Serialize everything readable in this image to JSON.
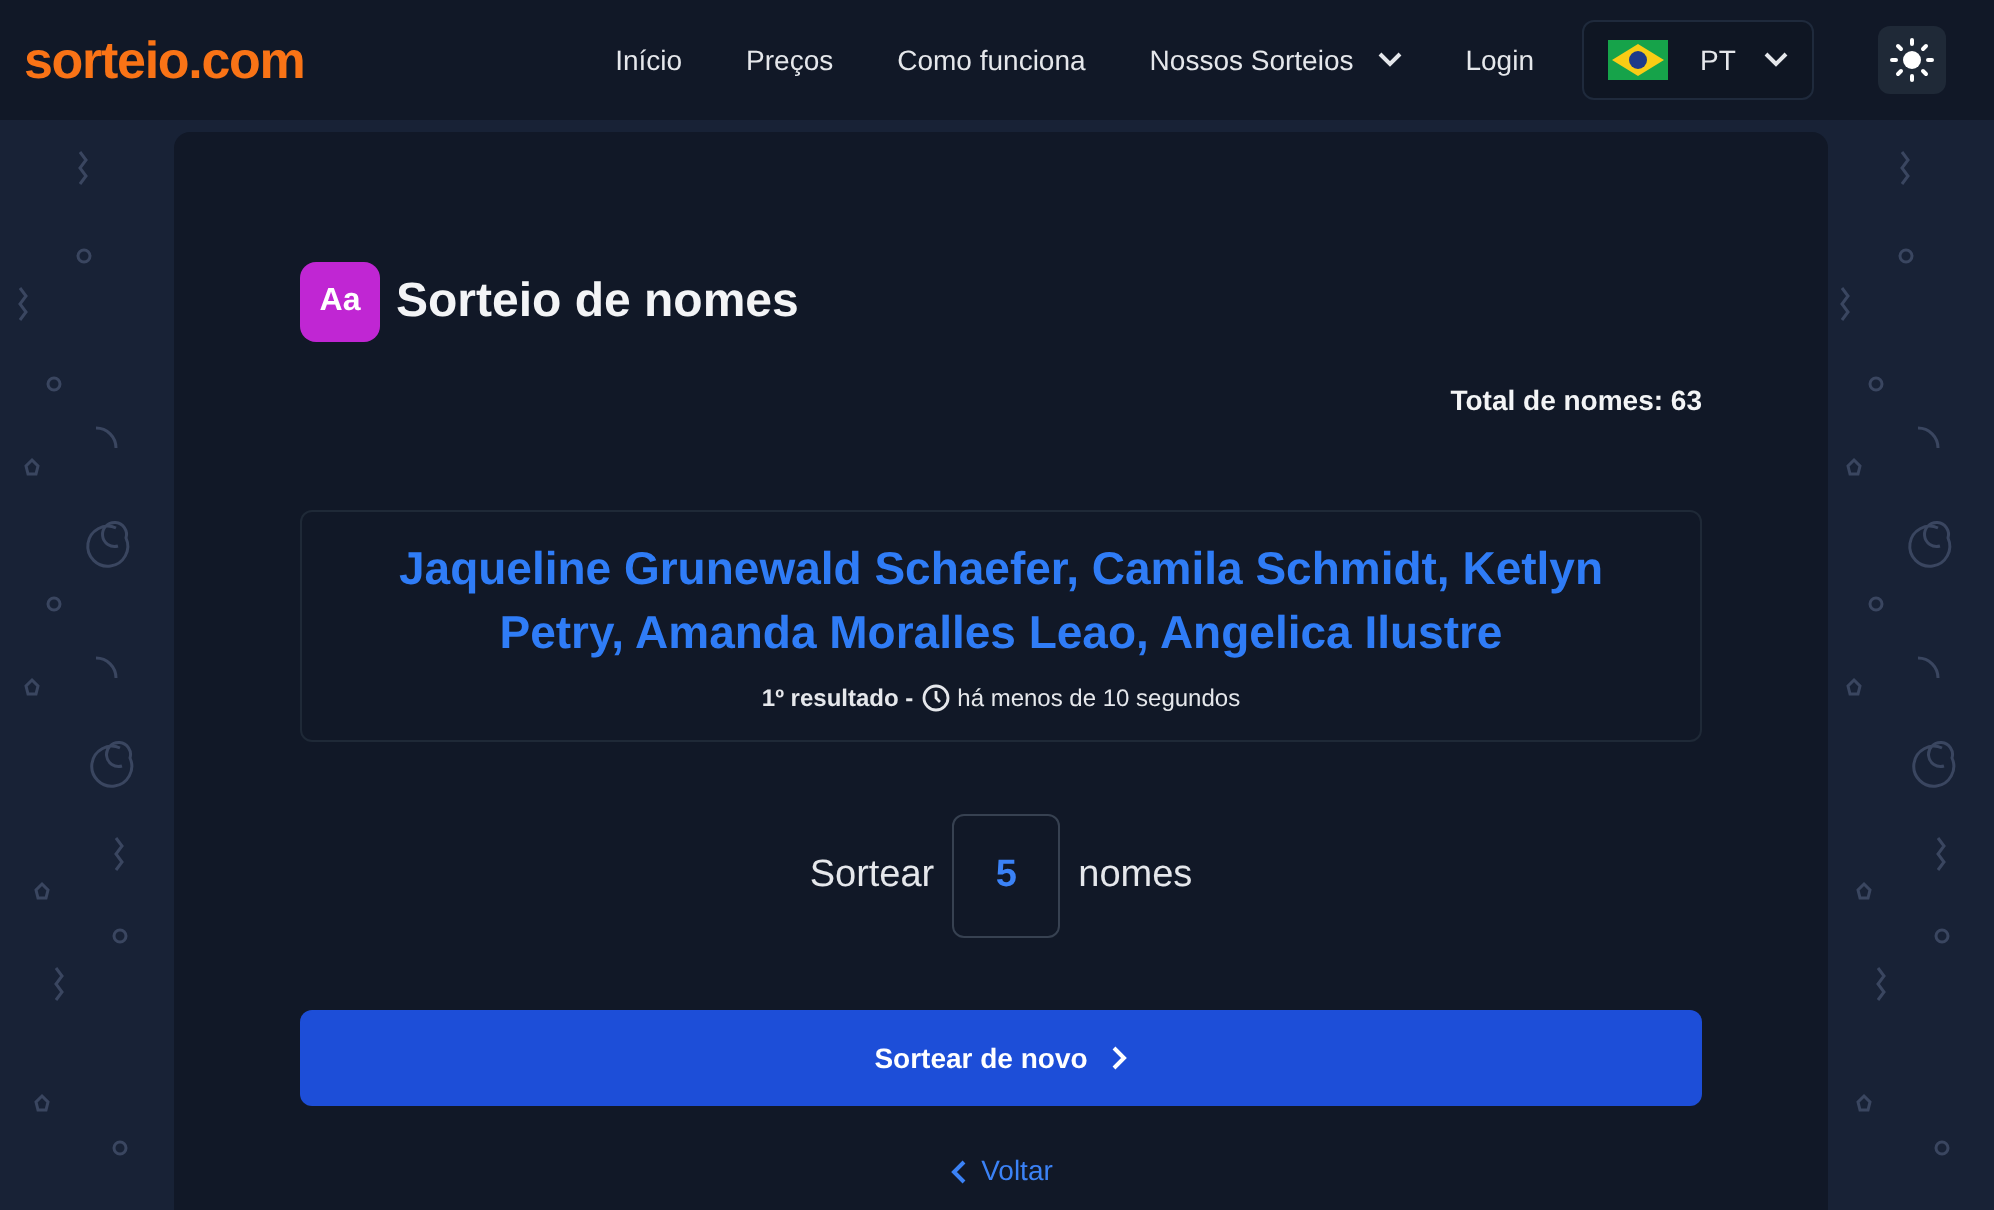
{
  "logo": "sorteio.com",
  "nav": [
    {
      "label": "Início",
      "dropdown": false
    },
    {
      "label": "Preços",
      "dropdown": false
    },
    {
      "label": "Como funciona",
      "dropdown": false
    },
    {
      "label": "Nossos Sorteios",
      "dropdown": true
    },
    {
      "label": "Login",
      "dropdown": false
    }
  ],
  "language": {
    "code": "PT"
  },
  "tool": {
    "icon_text": "Aa",
    "title": "Sorteio de nomes"
  },
  "total": "Total de nomes: 63",
  "result": {
    "names": "Jaqueline Grunewald Schaefer, Camila Schmidt, Ketlyn Petry, Amanda Moralles Leao, Angelica Ilustre",
    "label": "1º resultado -",
    "time": "há menos de 10 segundos"
  },
  "draw": {
    "before": "Sortear",
    "value": "5",
    "after": "nomes"
  },
  "primary_button": "Sortear de novo",
  "back_link": "Voltar"
}
